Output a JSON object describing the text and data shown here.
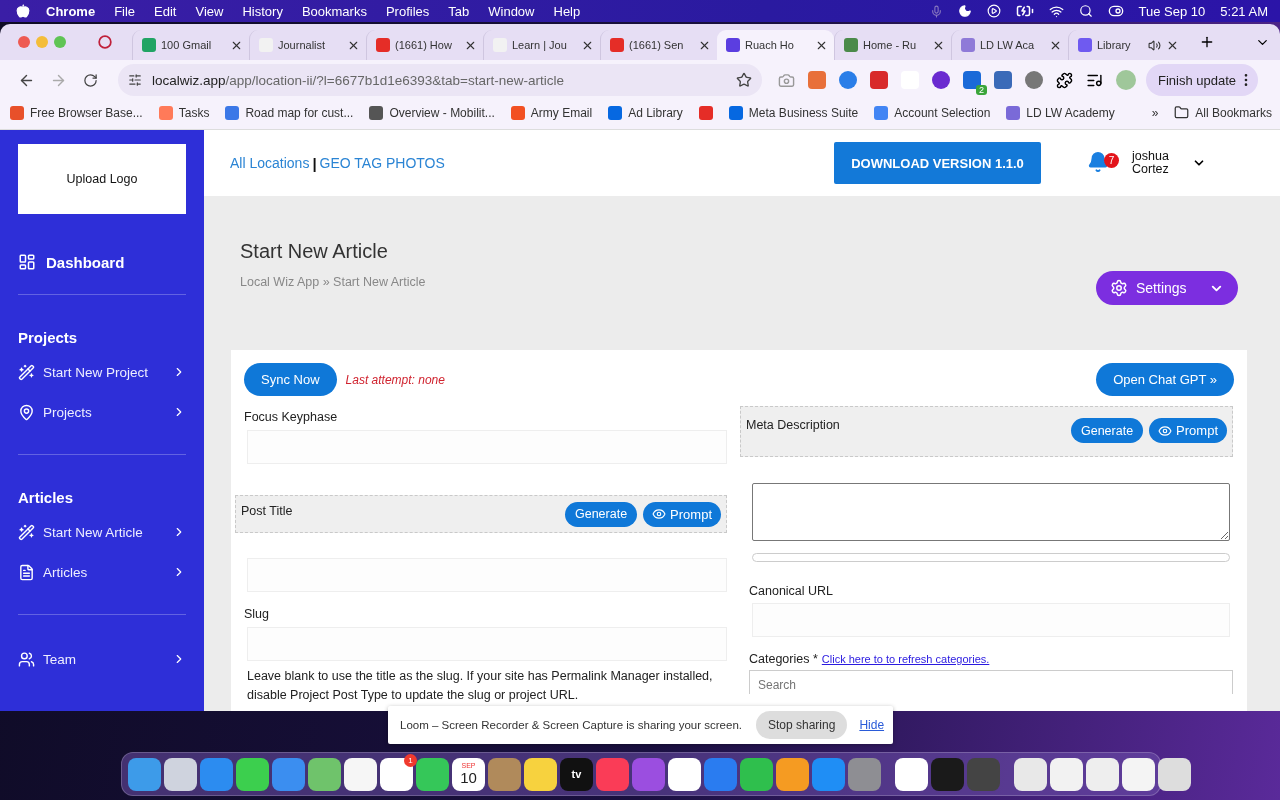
{
  "menu_bar": {
    "app": "Chrome",
    "menus": [
      "File",
      "Edit",
      "View",
      "History",
      "Bookmarks",
      "Profiles",
      "Tab",
      "Window",
      "Help"
    ],
    "date": "Tue Sep 10",
    "time": "5:21 AM"
  },
  "browser": {
    "tabs": [
      {
        "title": "100 Gmail",
        "selected": false,
        "audio": false
      },
      {
        "title": "Journalist",
        "selected": false,
        "audio": false
      },
      {
        "title": "(1661) How",
        "selected": false,
        "audio": false
      },
      {
        "title": "Learn | Jou",
        "selected": false,
        "audio": false
      },
      {
        "title": "(1661) Sen",
        "selected": false,
        "audio": false
      },
      {
        "title": "Ruach Ho",
        "selected": true,
        "audio": false
      },
      {
        "title": "Home - Ru",
        "selected": false,
        "audio": false
      },
      {
        "title": "LD LW Aca",
        "selected": false,
        "audio": false
      },
      {
        "title": "Library",
        "selected": false,
        "audio": true
      }
    ],
    "address": {
      "domain": "localwiz.app",
      "path": "/app/location-ii/?l=6677b1d1e6393&tab=start-new-article"
    },
    "extension_badge": "2",
    "update_button": "Finish update",
    "bookmarks": [
      {
        "kind": "link",
        "label": "Free Browser Base..."
      },
      {
        "kind": "link",
        "label": "Tasks"
      },
      {
        "kind": "link",
        "label": "Road map for cust..."
      },
      {
        "kind": "link",
        "label": "Overview - Mobilit..."
      },
      {
        "kind": "link",
        "label": "Army Email"
      },
      {
        "kind": "link",
        "label": "Ad Library"
      },
      {
        "kind": "icon"
      },
      {
        "kind": "link",
        "label": "Meta Business Suite"
      },
      {
        "kind": "link",
        "label": "Account Selection"
      },
      {
        "kind": "link",
        "label": "LD LW Academy"
      }
    ],
    "more_bookmarks": "»",
    "all_bookmarks": "All Bookmarks"
  },
  "sidebar": {
    "logo": "Upload Logo",
    "dashboard": "Dashboard",
    "sections": [
      {
        "title": "Projects",
        "items": [
          "Start New Project",
          "Projects"
        ]
      },
      {
        "title": "Articles",
        "items": [
          "Start New Article",
          "Articles"
        ]
      },
      {
        "items": [
          "Team"
        ]
      }
    ]
  },
  "topbar": {
    "links": [
      "All Locations",
      "GEO TAG PHOTOS"
    ],
    "separator": "|",
    "download": "DOWNLOAD VERSION 1.1.0",
    "notifications": "7",
    "user": "joshua Cortez"
  },
  "header": {
    "title": "Start New Article",
    "breadcrumb": "Local Wiz App » Start New Article",
    "settings": "Settings"
  },
  "form": {
    "sync": "Sync Now",
    "last_attempt": "Last attempt: none",
    "chat_gpt": "Open Chat GPT »",
    "focus_keyphrase": {
      "label": "Focus Keyphase"
    },
    "post_title": {
      "label": "Post Title",
      "generate": "Generate",
      "prompt": "Prompt"
    },
    "slug": {
      "label": "Slug",
      "help": "Leave blank to use the title as the slug. If your site has Permalink Manager installed, disable Project Post Type to update the slug or project URL."
    },
    "meta_description": {
      "label": "Meta Description",
      "generate": "Generate",
      "prompt": "Prompt",
      "level": 0
    },
    "canonical_url": {
      "label": "Canonical URL"
    },
    "categories": {
      "label": "Categories *",
      "refresh_link": "Click here to to refresh categories.",
      "placeholder": "Search"
    }
  },
  "loom": {
    "message": "Loom – Screen Recorder & Screen Capture is sharing your screen.",
    "stop": "Stop sharing",
    "hide": "Hide"
  },
  "dock": {
    "calendar_month": "SEP",
    "calendar_day": "10",
    "reminders_badge": "1",
    "tv_label": "tv"
  }
}
